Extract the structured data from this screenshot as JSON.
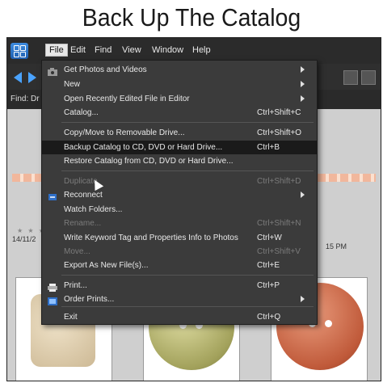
{
  "caption": "Back Up The Catalog",
  "menubar": {
    "items": [
      "File",
      "Edit",
      "Find",
      "View",
      "Window",
      "Help"
    ]
  },
  "findbar": {
    "label": "Find: Dr"
  },
  "content": {
    "date_left": "14/11/2",
    "time_right": "15 PM"
  },
  "file_menu": {
    "items": [
      {
        "label": "Get Photos and Videos",
        "shortcut": "",
        "submenu": true,
        "enabled": true,
        "icon": "camera-icon"
      },
      {
        "label": "New",
        "shortcut": "",
        "submenu": true,
        "enabled": true
      },
      {
        "label": "Open Recently Edited File in Editor",
        "shortcut": "",
        "submenu": true,
        "enabled": true
      },
      {
        "label": "Catalog...",
        "shortcut": "Ctrl+Shift+C",
        "submenu": false,
        "enabled": true
      },
      {
        "label": "Copy/Move to Removable Drive...",
        "shortcut": "Ctrl+Shift+O",
        "submenu": false,
        "enabled": true
      },
      {
        "label": "Backup Catalog to CD, DVD or Hard Drive...",
        "shortcut": "Ctrl+B",
        "submenu": false,
        "enabled": true,
        "highlighted": true
      },
      {
        "label": "Restore Catalog from CD, DVD or Hard Drive...",
        "shortcut": "",
        "submenu": false,
        "enabled": true
      },
      {
        "label": "Duplicate",
        "shortcut": "Ctrl+Shift+D",
        "submenu": false,
        "enabled": false
      },
      {
        "label": "Reconnect",
        "shortcut": "",
        "submenu": true,
        "enabled": true,
        "icon": "reconnect-icon"
      },
      {
        "label": "Watch Folders...",
        "shortcut": "",
        "submenu": false,
        "enabled": true
      },
      {
        "label": "Rename...",
        "shortcut": "Ctrl+Shift+N",
        "submenu": false,
        "enabled": false
      },
      {
        "label": "Write Keyword Tag and Properties Info to Photos",
        "shortcut": "Ctrl+W",
        "submenu": false,
        "enabled": true
      },
      {
        "label": "Move...",
        "shortcut": "Ctrl+Shift+V",
        "submenu": false,
        "enabled": false
      },
      {
        "label": "Export As New File(s)...",
        "shortcut": "Ctrl+E",
        "submenu": false,
        "enabled": true
      },
      {
        "label": "Print...",
        "shortcut": "Ctrl+P",
        "submenu": false,
        "enabled": true,
        "icon": "printer-icon"
      },
      {
        "label": "Order Prints...",
        "shortcut": "",
        "submenu": true,
        "enabled": true,
        "icon": "order-prints-icon"
      },
      {
        "label": "Exit",
        "shortcut": "Ctrl+Q",
        "submenu": false,
        "enabled": true
      }
    ]
  },
  "colors": {
    "accent": "#4aa3ff",
    "menu_bg": "#3b3b3b",
    "highlight": "#1a1a1a"
  }
}
